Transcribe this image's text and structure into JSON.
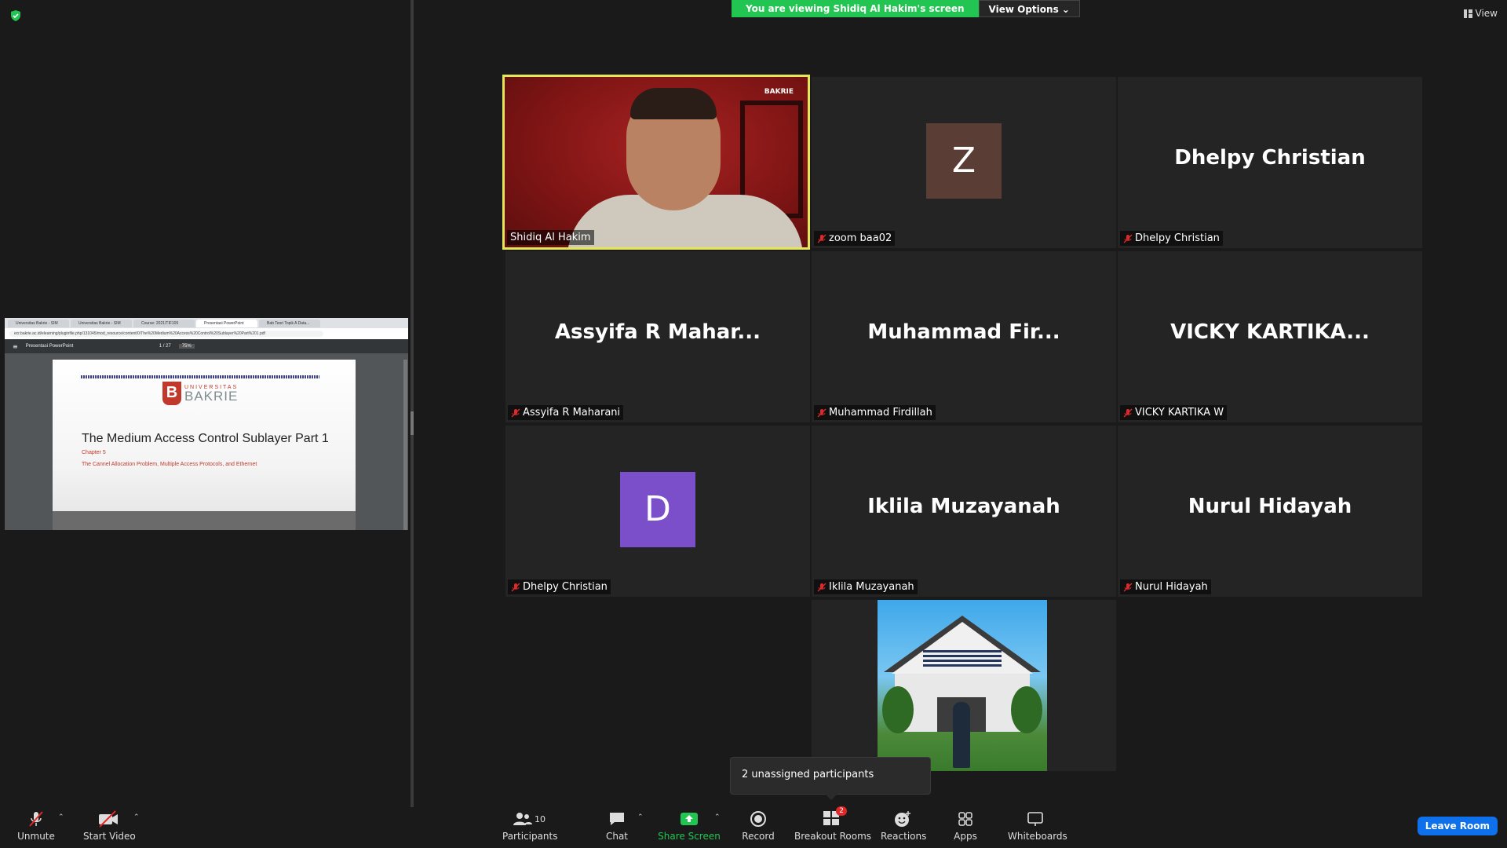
{
  "banner": {
    "viewing_text": "You are viewing Shidiq Al Hakim's screen",
    "view_options": "View Options"
  },
  "view_top": "View",
  "shared_screen": {
    "tabs": [
      "Universitas Bakrie - SIM",
      "Universitas Bakrie - SIM",
      "Course: 2021/TIF105",
      "Presentasi PowerPoint",
      "Bab Teori Topik A Data..."
    ],
    "url": "ecr.bakrie.ac.id/elearning/pluginfile.php/131045/mod_resource/content/0/The%20Medium%20Access%20Control%20Sublayer%20Part%201.pdf",
    "pdf_title": "Presentasi PowerPoint",
    "pdf_page": "1 / 27",
    "pdf_zoom": "75%",
    "slide": {
      "logo_small": "UNIVERSITAS",
      "logo_big": "BAKRIE",
      "logo_mark": "B",
      "title": "The Medium Access Control Sublayer Part 1",
      "chapter": "Chapter 5",
      "subtitle": "The Cannel Allocation Problem, Multiple Access Protocols, and Ethernet"
    }
  },
  "tiles": [
    {
      "label": "Shidiq Al Hakim",
      "muted": false,
      "kind": "video"
    },
    {
      "label": "zoom baa02",
      "muted": true,
      "kind": "avatar",
      "avatar_letter": "Z",
      "avatar_color": "#5a3e35"
    },
    {
      "label": "Dhelpy Christian",
      "muted": true,
      "kind": "name",
      "big_name": "Dhelpy Christian"
    },
    {
      "label": "Assyifa R Maharani",
      "muted": true,
      "kind": "name",
      "big_name": "Assyifa  R  Mahar..."
    },
    {
      "label": "Muhammad Firdillah",
      "muted": true,
      "kind": "name",
      "big_name": "Muhammad  Fir..."
    },
    {
      "label": "VICKY KARTIKA W",
      "muted": true,
      "kind": "name",
      "big_name": "VICKY  KARTIKA..."
    },
    {
      "label": "Dhelpy Christian",
      "muted": true,
      "kind": "avatar",
      "avatar_letter": "D",
      "avatar_color": "#7b4fc9"
    },
    {
      "label": "Iklila Muzayanah",
      "muted": true,
      "kind": "name",
      "big_name": "Iklila Muzayanah"
    },
    {
      "label": "Nurul Hidayah",
      "muted": true,
      "kind": "name",
      "big_name": "Nurul Hidayah"
    }
  ],
  "video_logo": "BAKRIE",
  "popup_text": "2 unassigned participants",
  "toolbar": {
    "unmute": "Unmute",
    "start_video": "Start Video",
    "participants": "Participants",
    "participants_count": "10",
    "chat": "Chat",
    "share_screen": "Share Screen",
    "record": "Record",
    "breakout_rooms": "Breakout Rooms",
    "breakout_badge": "2",
    "reactions": "Reactions",
    "apps": "Apps",
    "whiteboards": "Whiteboards",
    "leave_room": "Leave Room"
  },
  "colors": {
    "accent_green": "#23c552",
    "leave_blue": "#0e71eb",
    "active_border": "#e6e65a",
    "mute_red": "#e02828"
  }
}
